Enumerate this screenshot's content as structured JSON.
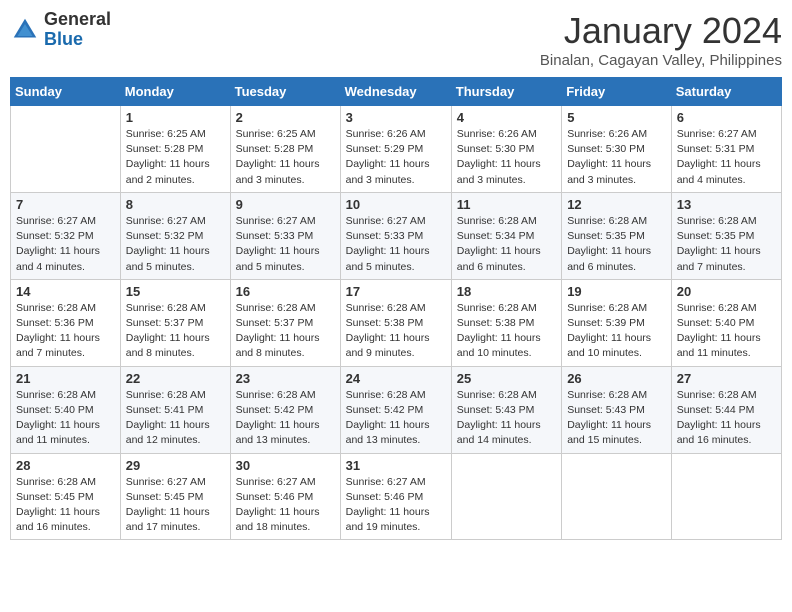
{
  "logo": {
    "general": "General",
    "blue": "Blue"
  },
  "title": "January 2024",
  "location": "Binalan, Cagayan Valley, Philippines",
  "weekdays": [
    "Sunday",
    "Monday",
    "Tuesday",
    "Wednesday",
    "Thursday",
    "Friday",
    "Saturday"
  ],
  "weeks": [
    [
      {
        "day": "",
        "sunrise": "",
        "sunset": "",
        "daylight": ""
      },
      {
        "day": "1",
        "sunrise": "Sunrise: 6:25 AM",
        "sunset": "Sunset: 5:28 PM",
        "daylight": "Daylight: 11 hours and 2 minutes."
      },
      {
        "day": "2",
        "sunrise": "Sunrise: 6:25 AM",
        "sunset": "Sunset: 5:28 PM",
        "daylight": "Daylight: 11 hours and 3 minutes."
      },
      {
        "day": "3",
        "sunrise": "Sunrise: 6:26 AM",
        "sunset": "Sunset: 5:29 PM",
        "daylight": "Daylight: 11 hours and 3 minutes."
      },
      {
        "day": "4",
        "sunrise": "Sunrise: 6:26 AM",
        "sunset": "Sunset: 5:30 PM",
        "daylight": "Daylight: 11 hours and 3 minutes."
      },
      {
        "day": "5",
        "sunrise": "Sunrise: 6:26 AM",
        "sunset": "Sunset: 5:30 PM",
        "daylight": "Daylight: 11 hours and 3 minutes."
      },
      {
        "day": "6",
        "sunrise": "Sunrise: 6:27 AM",
        "sunset": "Sunset: 5:31 PM",
        "daylight": "Daylight: 11 hours and 4 minutes."
      }
    ],
    [
      {
        "day": "7",
        "sunrise": "Sunrise: 6:27 AM",
        "sunset": "Sunset: 5:32 PM",
        "daylight": "Daylight: 11 hours and 4 minutes."
      },
      {
        "day": "8",
        "sunrise": "Sunrise: 6:27 AM",
        "sunset": "Sunset: 5:32 PM",
        "daylight": "Daylight: 11 hours and 5 minutes."
      },
      {
        "day": "9",
        "sunrise": "Sunrise: 6:27 AM",
        "sunset": "Sunset: 5:33 PM",
        "daylight": "Daylight: 11 hours and 5 minutes."
      },
      {
        "day": "10",
        "sunrise": "Sunrise: 6:27 AM",
        "sunset": "Sunset: 5:33 PM",
        "daylight": "Daylight: 11 hours and 5 minutes."
      },
      {
        "day": "11",
        "sunrise": "Sunrise: 6:28 AM",
        "sunset": "Sunset: 5:34 PM",
        "daylight": "Daylight: 11 hours and 6 minutes."
      },
      {
        "day": "12",
        "sunrise": "Sunrise: 6:28 AM",
        "sunset": "Sunset: 5:35 PM",
        "daylight": "Daylight: 11 hours and 6 minutes."
      },
      {
        "day": "13",
        "sunrise": "Sunrise: 6:28 AM",
        "sunset": "Sunset: 5:35 PM",
        "daylight": "Daylight: 11 hours and 7 minutes."
      }
    ],
    [
      {
        "day": "14",
        "sunrise": "Sunrise: 6:28 AM",
        "sunset": "Sunset: 5:36 PM",
        "daylight": "Daylight: 11 hours and 7 minutes."
      },
      {
        "day": "15",
        "sunrise": "Sunrise: 6:28 AM",
        "sunset": "Sunset: 5:37 PM",
        "daylight": "Daylight: 11 hours and 8 minutes."
      },
      {
        "day": "16",
        "sunrise": "Sunrise: 6:28 AM",
        "sunset": "Sunset: 5:37 PM",
        "daylight": "Daylight: 11 hours and 8 minutes."
      },
      {
        "day": "17",
        "sunrise": "Sunrise: 6:28 AM",
        "sunset": "Sunset: 5:38 PM",
        "daylight": "Daylight: 11 hours and 9 minutes."
      },
      {
        "day": "18",
        "sunrise": "Sunrise: 6:28 AM",
        "sunset": "Sunset: 5:38 PM",
        "daylight": "Daylight: 11 hours and 10 minutes."
      },
      {
        "day": "19",
        "sunrise": "Sunrise: 6:28 AM",
        "sunset": "Sunset: 5:39 PM",
        "daylight": "Daylight: 11 hours and 10 minutes."
      },
      {
        "day": "20",
        "sunrise": "Sunrise: 6:28 AM",
        "sunset": "Sunset: 5:40 PM",
        "daylight": "Daylight: 11 hours and 11 minutes."
      }
    ],
    [
      {
        "day": "21",
        "sunrise": "Sunrise: 6:28 AM",
        "sunset": "Sunset: 5:40 PM",
        "daylight": "Daylight: 11 hours and 11 minutes."
      },
      {
        "day": "22",
        "sunrise": "Sunrise: 6:28 AM",
        "sunset": "Sunset: 5:41 PM",
        "daylight": "Daylight: 11 hours and 12 minutes."
      },
      {
        "day": "23",
        "sunrise": "Sunrise: 6:28 AM",
        "sunset": "Sunset: 5:42 PM",
        "daylight": "Daylight: 11 hours and 13 minutes."
      },
      {
        "day": "24",
        "sunrise": "Sunrise: 6:28 AM",
        "sunset": "Sunset: 5:42 PM",
        "daylight": "Daylight: 11 hours and 13 minutes."
      },
      {
        "day": "25",
        "sunrise": "Sunrise: 6:28 AM",
        "sunset": "Sunset: 5:43 PM",
        "daylight": "Daylight: 11 hours and 14 minutes."
      },
      {
        "day": "26",
        "sunrise": "Sunrise: 6:28 AM",
        "sunset": "Sunset: 5:43 PM",
        "daylight": "Daylight: 11 hours and 15 minutes."
      },
      {
        "day": "27",
        "sunrise": "Sunrise: 6:28 AM",
        "sunset": "Sunset: 5:44 PM",
        "daylight": "Daylight: 11 hours and 16 minutes."
      }
    ],
    [
      {
        "day": "28",
        "sunrise": "Sunrise: 6:28 AM",
        "sunset": "Sunset: 5:45 PM",
        "daylight": "Daylight: 11 hours and 16 minutes."
      },
      {
        "day": "29",
        "sunrise": "Sunrise: 6:27 AM",
        "sunset": "Sunset: 5:45 PM",
        "daylight": "Daylight: 11 hours and 17 minutes."
      },
      {
        "day": "30",
        "sunrise": "Sunrise: 6:27 AM",
        "sunset": "Sunset: 5:46 PM",
        "daylight": "Daylight: 11 hours and 18 minutes."
      },
      {
        "day": "31",
        "sunrise": "Sunrise: 6:27 AM",
        "sunset": "Sunset: 5:46 PM",
        "daylight": "Daylight: 11 hours and 19 minutes."
      },
      {
        "day": "",
        "sunrise": "",
        "sunset": "",
        "daylight": ""
      },
      {
        "day": "",
        "sunrise": "",
        "sunset": "",
        "daylight": ""
      },
      {
        "day": "",
        "sunrise": "",
        "sunset": "",
        "daylight": ""
      }
    ]
  ]
}
